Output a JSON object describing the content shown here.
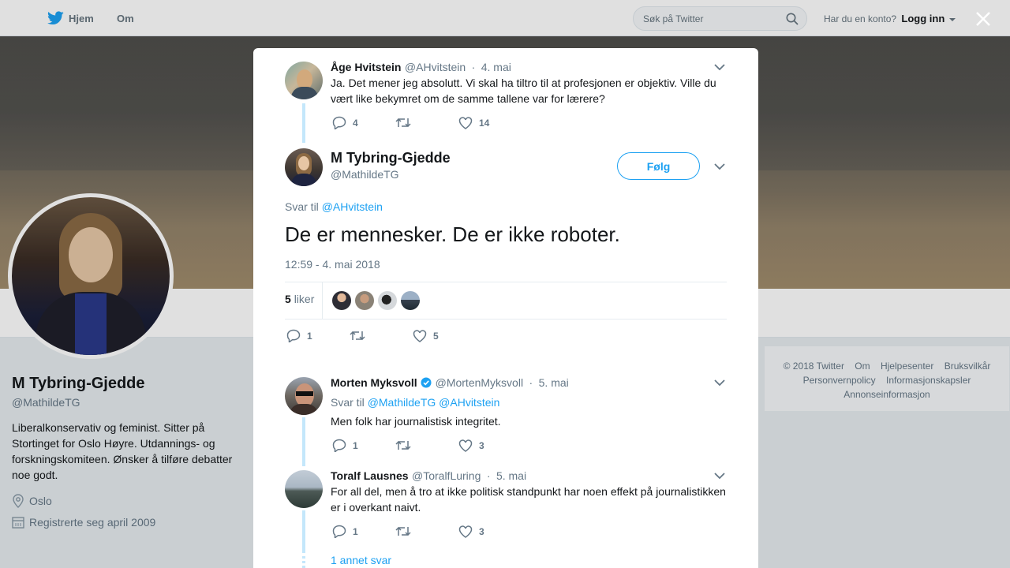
{
  "nav": {
    "home_label": "Hjem",
    "about_label": "Om",
    "search_placeholder": "Søk på Twitter",
    "account_question": "Har du en konto?",
    "login_label": "Logg inn"
  },
  "profile": {
    "name": "M Tybring-Gjedde",
    "handle": "@MathildeTG",
    "bio": "Liberalkonservativ og feminist. Sitter på Stortinget for Oslo Høyre. Utdannings- og forskningskomiteen. Ønsker å tilføre debatter noe godt.",
    "location": "Oslo",
    "joined": "Registrerte seg april 2009"
  },
  "footer": {
    "links": [
      "© 2018 Twitter",
      "Om",
      "Hjelpesenter",
      "Bruksvilkår",
      "Personvernpolicy",
      "Informasjonskapsler",
      "Annonseinformasjon"
    ]
  },
  "parent_tweet": {
    "name": "Åge Hvitstein",
    "handle": "@AHvitstein",
    "date": "4. mai",
    "text": "Ja. Det mener jeg absolutt. Vi skal ha tiltro til at profesjonen er objektiv. Ville du vært like bekymret om de samme tallene var for lærere?",
    "replies": "4",
    "likes": "14"
  },
  "main_tweet": {
    "name": "M Tybring-Gjedde",
    "handle": "@MathildeTG",
    "follow_label": "Følg",
    "reply_prefix": "Svar til",
    "reply_to": "@AHvitstein",
    "text": "De er mennesker. De er ikke roboter.",
    "timestamp": "12:59 - 4. mai 2018",
    "likes_count": "5",
    "likes_label": "liker",
    "replies": "1",
    "likes": "5"
  },
  "replies": [
    {
      "name": "Morten Myksvoll",
      "handle": "@MortenMyksvoll",
      "date": "5. mai",
      "reply_prefix": "Svar til",
      "reply_to_1": "@MathildeTG",
      "reply_to_2": "@AHvitstein",
      "text": "Men folk har journalistisk integritet.",
      "replies": "1",
      "likes": "3",
      "verified": true
    },
    {
      "name": "Toralf Lausnes",
      "handle": "@ToralfLuring",
      "date": "5. mai",
      "text": "For all del, men å tro at ikke politisk standpunkt har noen effekt på journalistikken er i overkant naivt.",
      "replies": "1",
      "likes": "3"
    }
  ],
  "more_replies": "1 annet svar",
  "colors": {
    "accent": "#1da1f2",
    "text": "#14171a",
    "muted": "#657786"
  }
}
